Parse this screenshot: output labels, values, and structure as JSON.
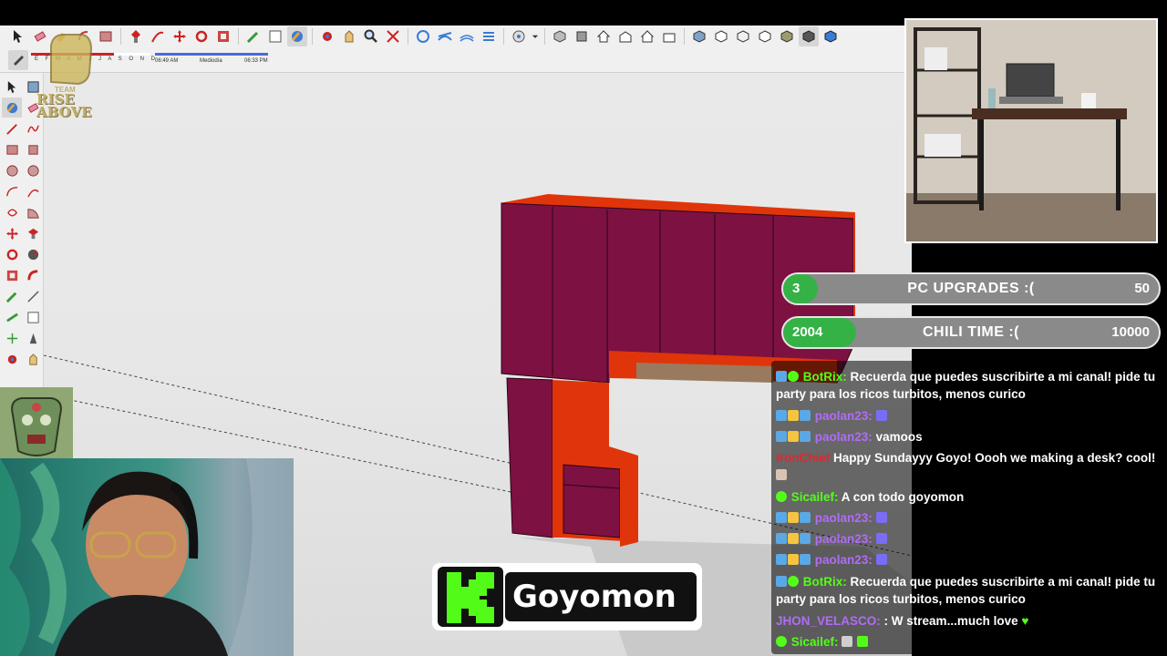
{
  "shadow_settings": {
    "months": "E F M A M J J A S O N D",
    "time_start": "06:49 AM",
    "time_mid": "Mediodía",
    "time_end": "06:33 PM"
  },
  "overlay": {
    "team_logo_text": "RISE ABOVE",
    "team_logo_small": "TEAM",
    "streamer_name": "Goyomon"
  },
  "goals": [
    {
      "current": "3",
      "title": "PC UPGRADES :(",
      "target": "50",
      "progress": 0.06
    },
    {
      "current": "2004",
      "title": "CHILI TIME :(",
      "target": "10000",
      "progress": 0.2
    }
  ],
  "chat": [
    {
      "user": "BotRix:",
      "user_color": "#53fc18",
      "text": "Recuerda que puedes suscribirte a mi canal! pide tu party para los ricos turbitos, menos curico",
      "badges": [
        "#5aa9e6",
        "#53fc18"
      ]
    },
    {
      "user": "paolan23:",
      "user_color": "#b06cf5",
      "text": "",
      "badges": [
        "#5aa9e6",
        "#f5c542",
        "#5aa9e6"
      ]
    },
    {
      "user": "paolan23:",
      "user_color": "#b06cf5",
      "text": "vamoos",
      "badges": [
        "#5aa9e6",
        "#f5c542",
        "#5aa9e6"
      ]
    },
    {
      "user": "IronChief",
      "user_color": "#e0282e",
      "text": "Happy Sundayyy Goyo! Oooh we making a desk? cool!",
      "badges": []
    },
    {
      "user": "Sicailef:",
      "user_color": "#53fc18",
      "text": "A con todo goyomon",
      "badges": [
        "#53fc18"
      ]
    },
    {
      "user": "paolan23:",
      "user_color": "#b06cf5",
      "text": "",
      "badges": [
        "#5aa9e6",
        "#f5c542",
        "#5aa9e6"
      ]
    },
    {
      "user": "paolan23:",
      "user_color": "#b06cf5",
      "text": "",
      "badges": [
        "#5aa9e6",
        "#f5c542",
        "#5aa9e6"
      ]
    },
    {
      "user": "paolan23:",
      "user_color": "#b06cf5",
      "text": "",
      "badges": [
        "#5aa9e6",
        "#f5c542",
        "#5aa9e6"
      ]
    },
    {
      "user": "BotRix:",
      "user_color": "#53fc18",
      "text": "Recuerda que puedes suscribirte a mi canal! pide tu party para los ricos turbitos, menos curico",
      "badges": [
        "#5aa9e6",
        "#53fc18"
      ]
    },
    {
      "user": "JHON_VELASCO:",
      "user_color": "#b06cf5",
      "text": ": W stream...much love",
      "badges": []
    },
    {
      "user": "Sicailef:",
      "user_color": "#53fc18",
      "text": "",
      "badges": [
        "#53fc18"
      ]
    }
  ],
  "colors": {
    "cabinet_front": "#7d1142",
    "cabinet_side": "#e0350a",
    "kick_green": "#53fc18",
    "goal_fill": "#35b246"
  },
  "toolbar_icons": [
    "select-icon",
    "eraser-icon",
    "paint-icon",
    "shape-icon",
    "move-icon",
    "rotate-icon",
    "tape-icon",
    "zoom-icon",
    "orbit-icon",
    "camera-icon",
    "house-icon",
    "views-icon",
    "style-icon"
  ]
}
